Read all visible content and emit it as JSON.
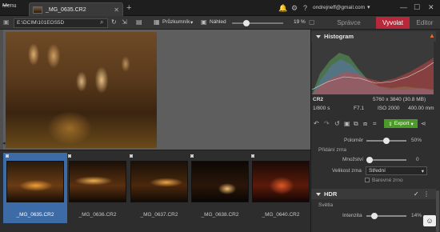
{
  "titlebar": {
    "menu_label": "Menu",
    "tab_title": "_MG_0635.CR2",
    "new_tab": "+",
    "account_email": "ondrejneff@gmail.com",
    "account_caret": "▾"
  },
  "toolbar": {
    "path": "E:\\DCIM\\101EOS5D",
    "browse_label": "Průzkumník",
    "preview_label": "Náhled",
    "zoom_value": 0.3,
    "zoom_label": "19 %"
  },
  "modes": {
    "spravce": "Správce",
    "vyvolat": "Vyvolat",
    "editor": "Editor",
    "active": "vyvolat"
  },
  "filmstrip": [
    {
      "name": "_MG_0635.CR2",
      "selected": true
    },
    {
      "name": "_MG_0636.CR2",
      "selected": false
    },
    {
      "name": "_MG_0637.CR2",
      "selected": false
    },
    {
      "name": "_MG_0638.CR2",
      "selected": false
    },
    {
      "name": "_MG_0640.CR2",
      "selected": false
    }
  ],
  "histogram": {
    "title": "Histogram",
    "format": "CR2",
    "dimensions": "5760 x 3840 (30.8 MB)",
    "shutter": "1/800 s",
    "aperture": "F7.1",
    "iso": "ISO 2000",
    "focal": "400.00 mm"
  },
  "actions": {
    "export_label": "Export"
  },
  "grain": {
    "poloměr_label": "Poloměr",
    "poloměr_value": "50%",
    "poloměr_fraction": 0.5,
    "pridani_label": "Přidání zrna",
    "mnozstvi_label": "Množství",
    "mnozstvi_value": "0",
    "velikost_label": "Velikost zrna",
    "velikost_value": "Střední",
    "barevne_label": "Barevné zrno"
  },
  "hdr": {
    "title": "HDR",
    "svetla_label": "Světla",
    "intenzita_label": "Intenzita",
    "intenzita_value": "14%"
  },
  "colors": {
    "accent_red": "#b8283a",
    "export_green": "#4c9a2a",
    "selected_blue": "#3d6ba6"
  },
  "help_glyph": "☺"
}
